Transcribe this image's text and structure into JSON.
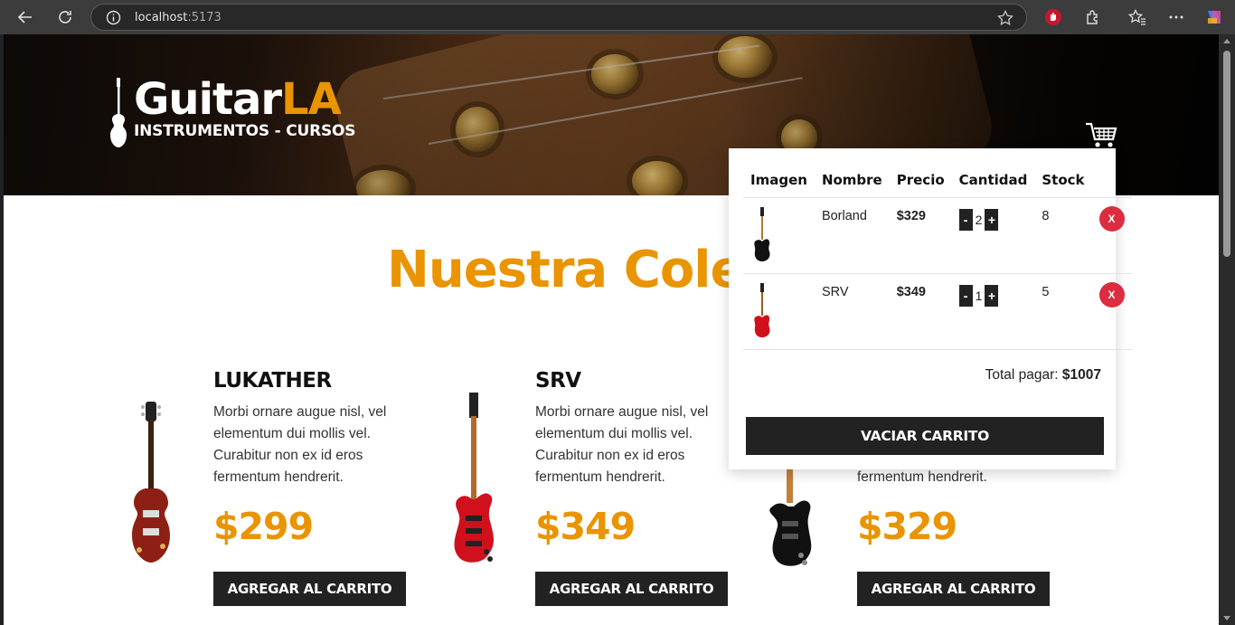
{
  "browser": {
    "url_host": "localhost",
    "url_port": ":5173",
    "icons": [
      "back-arrow-icon",
      "reload-icon",
      "info-icon",
      "star-icon",
      "extension-icon",
      "puzzle-icon",
      "favorites-icon",
      "more-icon",
      "copilot-icon"
    ]
  },
  "header": {
    "brand_main": "Guitar",
    "brand_accent": "LA",
    "tagline": "INSTRUMENTOS - CURSOS",
    "accent_color": "#e99400"
  },
  "collection": {
    "title": "Nuestra Colec"
  },
  "products": [
    {
      "name": "LUKATHER",
      "description": "Morbi ornare augue nisl, vel elementum dui mollis vel. Curabitur non ex id eros fermentum hendrerit.",
      "price": "$299",
      "button": "AGREGAR AL CARRITO"
    },
    {
      "name": "SRV",
      "description": "Morbi ornare augue nisl, vel elementum dui mollis vel. Curabitur non ex id eros fermentum hendrerit.",
      "price": "$349",
      "button": "AGREGAR AL CARRITO"
    },
    {
      "name": "",
      "description": "fermentum hendrerit.",
      "price": "$329",
      "button": "AGREGAR AL CARRITO"
    }
  ],
  "cart": {
    "headers": [
      "Imagen",
      "Nombre",
      "Precio",
      "Cantidad",
      "Stock"
    ],
    "items": [
      {
        "name": "Borland",
        "price": "$329",
        "quantity": "2",
        "stock": "8",
        "minus": "-",
        "plus": "+",
        "remove": "X"
      },
      {
        "name": "SRV",
        "price": "$349",
        "quantity": "1",
        "stock": "5",
        "minus": "-",
        "plus": "+",
        "remove": "X"
      }
    ],
    "total_label": "Total pagar: ",
    "total_value": "$1007",
    "empty_button": "VACIAR CARRITO"
  }
}
